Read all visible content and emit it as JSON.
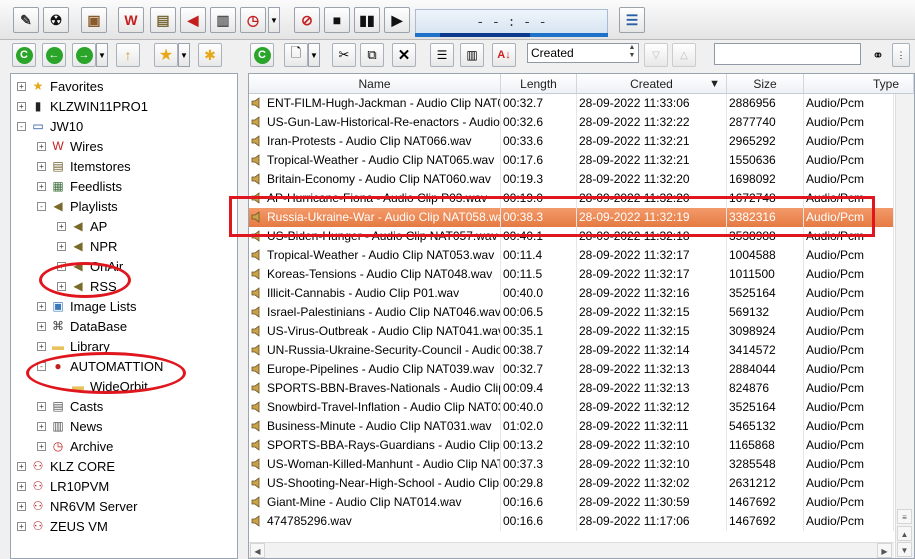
{
  "toolbar": {
    "buttons": [
      {
        "name": "tools-icon",
        "glyph": "✎"
      },
      {
        "name": "bomb-icon",
        "glyph": "☢"
      },
      {
        "name": "box-icon",
        "glyph": "▣"
      },
      {
        "name": "wires-icon",
        "glyph": "W"
      },
      {
        "name": "script-icon",
        "glyph": "▤"
      },
      {
        "name": "speaker-icon",
        "glyph": "◀"
      },
      {
        "name": "cart-icon",
        "glyph": "▥"
      },
      {
        "name": "clock-icon",
        "glyph": "◷"
      },
      {
        "name": "stop-red-icon",
        "glyph": "⊘"
      },
      {
        "name": "stop-icon",
        "glyph": "■"
      },
      {
        "name": "pause-icon",
        "glyph": "▮▮"
      },
      {
        "name": "play-icon",
        "glyph": "▶"
      },
      {
        "name": "log-icon",
        "glyph": "☰"
      }
    ],
    "time_display": "- - : - -"
  },
  "left_toolbar": {
    "refresh": "C",
    "back": "←",
    "forward": "→",
    "up": "↑",
    "favorite": "★",
    "add_favorite": "✱"
  },
  "tree": {
    "items": [
      {
        "label": "Favorites",
        "icon": "star-icon"
      },
      {
        "label": "KLZWIN11PRO1",
        "icon": "computer-icon"
      },
      {
        "label": "JW10",
        "icon": "monitor-icon"
      },
      {
        "label": "Wires",
        "icon": "wires-icon"
      },
      {
        "label": "Itemstores",
        "icon": "itemstores-icon"
      },
      {
        "label": "Feedlists",
        "icon": "feedlists-icon"
      },
      {
        "label": "Playlists",
        "icon": "speaker-icon"
      },
      {
        "label": "AP",
        "icon": "speaker-icon"
      },
      {
        "label": "NPR",
        "icon": "speaker-icon"
      },
      {
        "label": "OnAir",
        "icon": "speaker-icon"
      },
      {
        "label": "RSS",
        "icon": "speaker-icon"
      },
      {
        "label": "Image Lists",
        "icon": "image-icon"
      },
      {
        "label": "DataBase",
        "icon": "database-icon"
      },
      {
        "label": "Library",
        "icon": "folder-icon"
      },
      {
        "label": "AUTOMATTION",
        "icon": "record-icon"
      },
      {
        "label": "WideOrbit",
        "icon": "folder-icon"
      },
      {
        "label": "Casts",
        "icon": "casts-icon"
      },
      {
        "label": "News",
        "icon": "news-icon"
      },
      {
        "label": "Archive",
        "icon": "clock-icon"
      },
      {
        "label": "KLZ CORE",
        "icon": "network-icon"
      },
      {
        "label": "LR10PVM",
        "icon": "network-icon"
      },
      {
        "label": "NR6VM Server",
        "icon": "network-icon"
      },
      {
        "label": "ZEUS VM",
        "icon": "network-icon"
      }
    ]
  },
  "right_toolbar": {
    "sort_value": "Created",
    "search_value": ""
  },
  "grid": {
    "columns": [
      "Name",
      "Length",
      "Created",
      "Size",
      "Type"
    ],
    "sort_indicator": "▼",
    "rows": [
      [
        "ENT-FILM-Hugh-Jackman - Audio Clip NAT067.wav",
        "00:32.7",
        "28-09-2022 11:33:06",
        "2886956",
        "Audio/Pcm"
      ],
      [
        "US-Gun-Law-Historical-Re-enactors - Audio Clip NAT068.wav",
        "00:32.6",
        "28-09-2022 11:32:22",
        "2877740",
        "Audio/Pcm"
      ],
      [
        "Iran-Protests - Audio Clip NAT066.wav",
        "00:33.6",
        "28-09-2022 11:32:21",
        "2965292",
        "Audio/Pcm"
      ],
      [
        "Tropical-Weather - Audio Clip NAT065.wav",
        "00:17.6",
        "28-09-2022 11:32:21",
        "1550636",
        "Audio/Pcm"
      ],
      [
        "Britain-Economy - Audio Clip NAT060.wav",
        "00:19.3",
        "28-09-2022 11:32:20",
        "1698092",
        "Audio/Pcm"
      ],
      [
        "AP-Hurricane-Fiona - Audio Clip P03.wav",
        "00:19.0",
        "28-09-2022 11:32:20",
        "1672748",
        "Audio/Pcm"
      ],
      [
        "Russia-Ukraine-War - Audio Clip NAT058.wav",
        "00:38.3",
        "28-09-2022 11:32:19",
        "3382316",
        "Audio/Pcm"
      ],
      [
        "US-Biden-Hunger - Audio Clip NAT057.wav",
        "00:40.1",
        "28-09-2022 11:32:18",
        "3538988",
        "Audio/Pcm"
      ],
      [
        "Tropical-Weather - Audio Clip NAT053.wav",
        "00:11.4",
        "28-09-2022 11:32:17",
        "1004588",
        "Audio/Pcm"
      ],
      [
        "Koreas-Tensions - Audio Clip NAT048.wav",
        "00:11.5",
        "28-09-2022 11:32:17",
        "1011500",
        "Audio/Pcm"
      ],
      [
        "Illicit-Cannabis - Audio Clip P01.wav",
        "00:40.0",
        "28-09-2022 11:32:16",
        "3525164",
        "Audio/Pcm"
      ],
      [
        "Israel-Palestinians - Audio Clip NAT046.wav",
        "00:06.5",
        "28-09-2022 11:32:15",
        "569132",
        "Audio/Pcm"
      ],
      [
        "US-Virus-Outbreak - Audio Clip NAT041.wav",
        "00:35.1",
        "28-09-2022 11:32:15",
        "3098924",
        "Audio/Pcm"
      ],
      [
        "UN-Russia-Ukraine-Security-Council - Audio Clip NAT040.wav",
        "00:38.7",
        "28-09-2022 11:32:14",
        "3414572",
        "Audio/Pcm"
      ],
      [
        "Europe-Pipelines - Audio Clip NAT039.wav",
        "00:32.7",
        "28-09-2022 11:32:13",
        "2884044",
        "Audio/Pcm"
      ],
      [
        "SPORTS-BBN-Braves-Nationals - Audio Clip NAT035.wav",
        "00:09.4",
        "28-09-2022 11:32:13",
        "824876",
        "Audio/Pcm"
      ],
      [
        "Snowbird-Travel-Inflation - Audio Clip NAT034.wav",
        "00:40.0",
        "28-09-2022 11:32:12",
        "3525164",
        "Audio/Pcm"
      ],
      [
        "Business-Minute - Audio Clip NAT031.wav",
        "01:02.0",
        "28-09-2022 11:32:11",
        "5465132",
        "Audio/Pcm"
      ],
      [
        "SPORTS-BBA-Rays-Guardians - Audio Clip NAT030.wav",
        "00:13.2",
        "28-09-2022 11:32:10",
        "1165868",
        "Audio/Pcm"
      ],
      [
        "US-Woman-Killed-Manhunt - Audio Clip NAT018.wav",
        "00:37.3",
        "28-09-2022 11:32:10",
        "3285548",
        "Audio/Pcm"
      ],
      [
        "US-Shooting-Near-High-School - Audio Clip NAT017.wav",
        "00:29.8",
        "28-09-2022 11:32:02",
        "2631212",
        "Audio/Pcm"
      ],
      [
        "Giant-Mine - Audio Clip NAT014.wav",
        "00:16.6",
        "28-09-2022 11:30:59",
        "1467692",
        "Audio/Pcm"
      ],
      [
        "474785296.wav",
        "00:16.6",
        "28-09-2022 11:17:06",
        "1467692",
        "Audio/Pcm"
      ]
    ]
  },
  "colors": {
    "selection": "#e57a43",
    "annotation": "#e0161e"
  }
}
